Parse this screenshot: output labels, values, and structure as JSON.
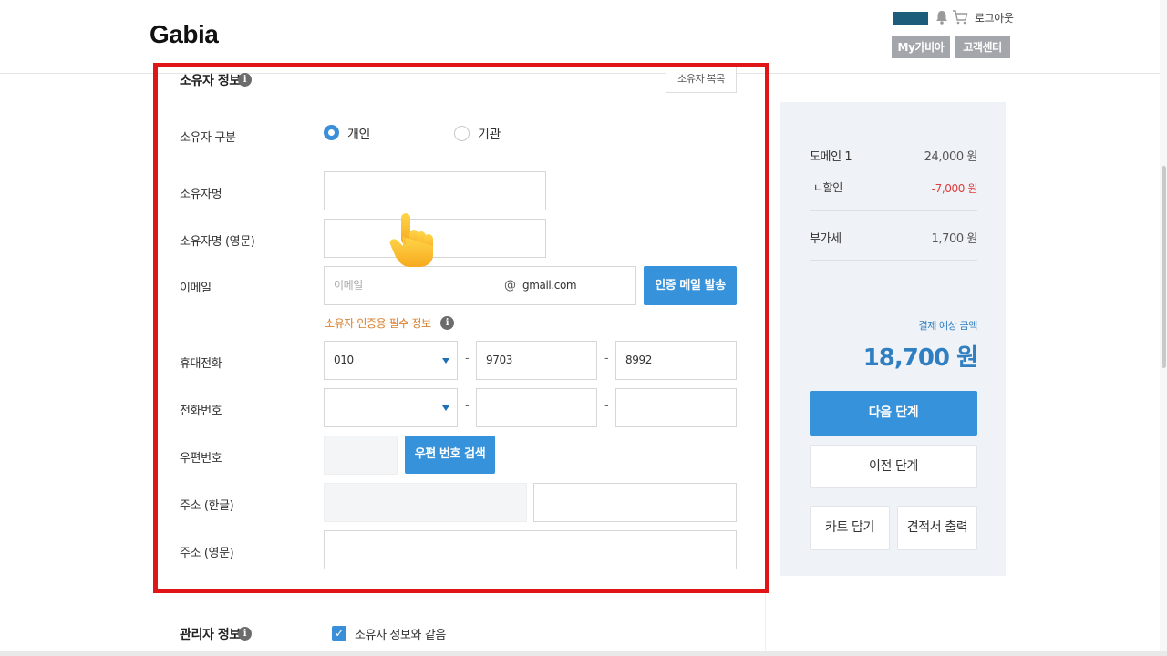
{
  "header": {
    "logo": "Gabia",
    "logout": "로그아웃",
    "mygabia": "My가비아",
    "support": "고객센터"
  },
  "owner": {
    "title": "소유자 정보",
    "copy_button": "소유자 복목",
    "type_label": "소유자 구분",
    "type_options": [
      "개인",
      "기관"
    ],
    "type_selected": "개인",
    "name_label": "소유자명",
    "name_value": "",
    "name_en_label": "소유자명 (영문)",
    "name_en_value": "",
    "email_label": "이메일",
    "email_placeholder": "이메일",
    "email_at": "@",
    "email_domain": "gmail.com",
    "send_mail_button": "인증 메일 발송",
    "hint": "소유자 인증용 필수 정보",
    "mobile_label": "휴대전화",
    "mobile": [
      "010",
      "9703",
      "8992"
    ],
    "phone_label": "전화번호",
    "phone": [
      "",
      "",
      ""
    ],
    "dash": "-",
    "zip_label": "우편번호",
    "zip_button": "우편 번호 검색",
    "addr_kr_label": "주소 (한글)",
    "addr_en_label": "주소 (영문)"
  },
  "admin": {
    "title": "관리자 정보",
    "same_as_owner": "소유자 정보와 같음",
    "same_checked": true
  },
  "summary": {
    "domain_label": "도메인 1",
    "domain_price": "24,000 원",
    "discount_label": "ㄴ할인",
    "discount_value": "-7,000 원",
    "vat_label": "부가세",
    "vat_value": "1,700 원",
    "total_caption": "결제 예상 금액",
    "total": "18,700 원",
    "next_button": "다음 단계",
    "prev_button": "이전 단계",
    "cart_button": "카트 담기",
    "quote_button": "견적서 출력"
  },
  "colors": {
    "accent": "#3592db",
    "annotation": "#e01515",
    "hint": "#d87f2c",
    "discount": "#e03b3b"
  },
  "icons": [
    "bell-icon",
    "cart-icon",
    "info-icon",
    "chevron-down-icon",
    "pointing-hand-icon",
    "check-icon"
  ]
}
